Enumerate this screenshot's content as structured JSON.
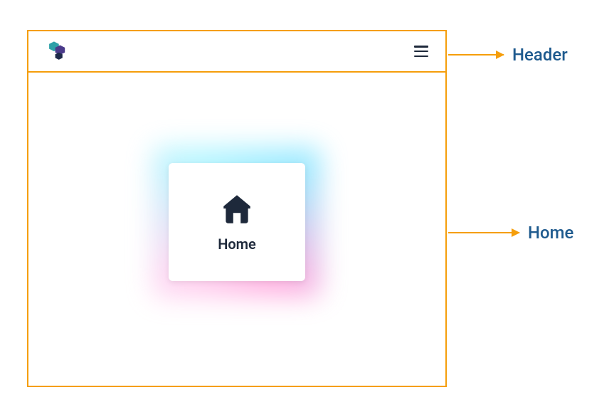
{
  "app": {
    "logo_name": "app-logo",
    "menu_name": "menu-icon"
  },
  "home": {
    "card_label": "Home",
    "icon_name": "home-icon"
  },
  "annotations": {
    "header_label": "Header",
    "home_label": "Home"
  },
  "colors": {
    "frame_border": "#f59e0b",
    "annotation_text": "#1e5a8e",
    "icon_dark": "#1e293b"
  }
}
